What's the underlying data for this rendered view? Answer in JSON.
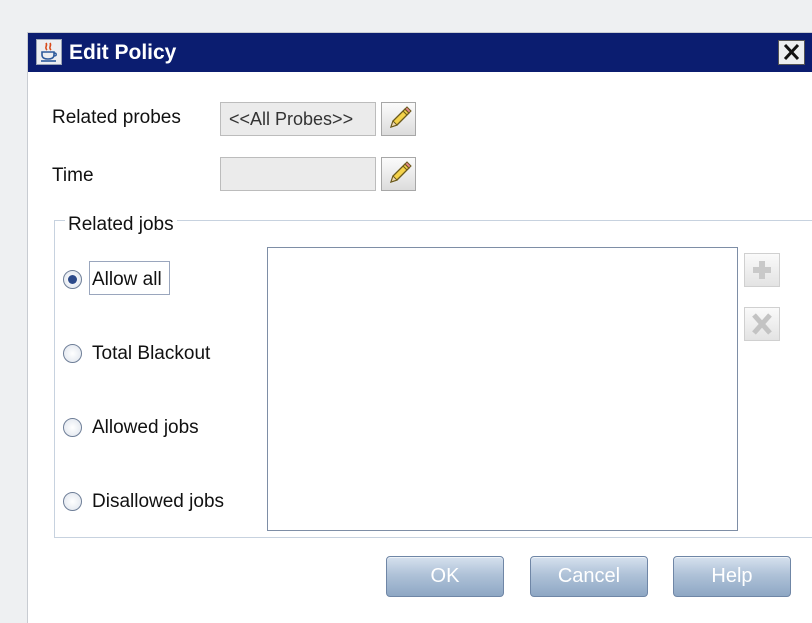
{
  "dialog": {
    "title": "Edit Policy",
    "title_icon": "java-cup-icon",
    "close_icon": "close-x-icon"
  },
  "form": {
    "related_probes_label": "Related probes",
    "related_probes_value": "<<All Probes>>",
    "time_label": "Time",
    "time_value": "",
    "edit_icon": "pencil-icon"
  },
  "related_jobs": {
    "legend": "Related jobs",
    "options": [
      {
        "label": "Allow all",
        "checked": true
      },
      {
        "label": "Total Blackout",
        "checked": false
      },
      {
        "label": "Allowed jobs",
        "checked": false
      },
      {
        "label": "Disallowed jobs",
        "checked": false
      }
    ],
    "jobs": [],
    "add_icon": "plus-icon",
    "remove_icon": "x-icon"
  },
  "buttons": {
    "ok": "OK",
    "cancel": "Cancel",
    "help": "Help"
  }
}
